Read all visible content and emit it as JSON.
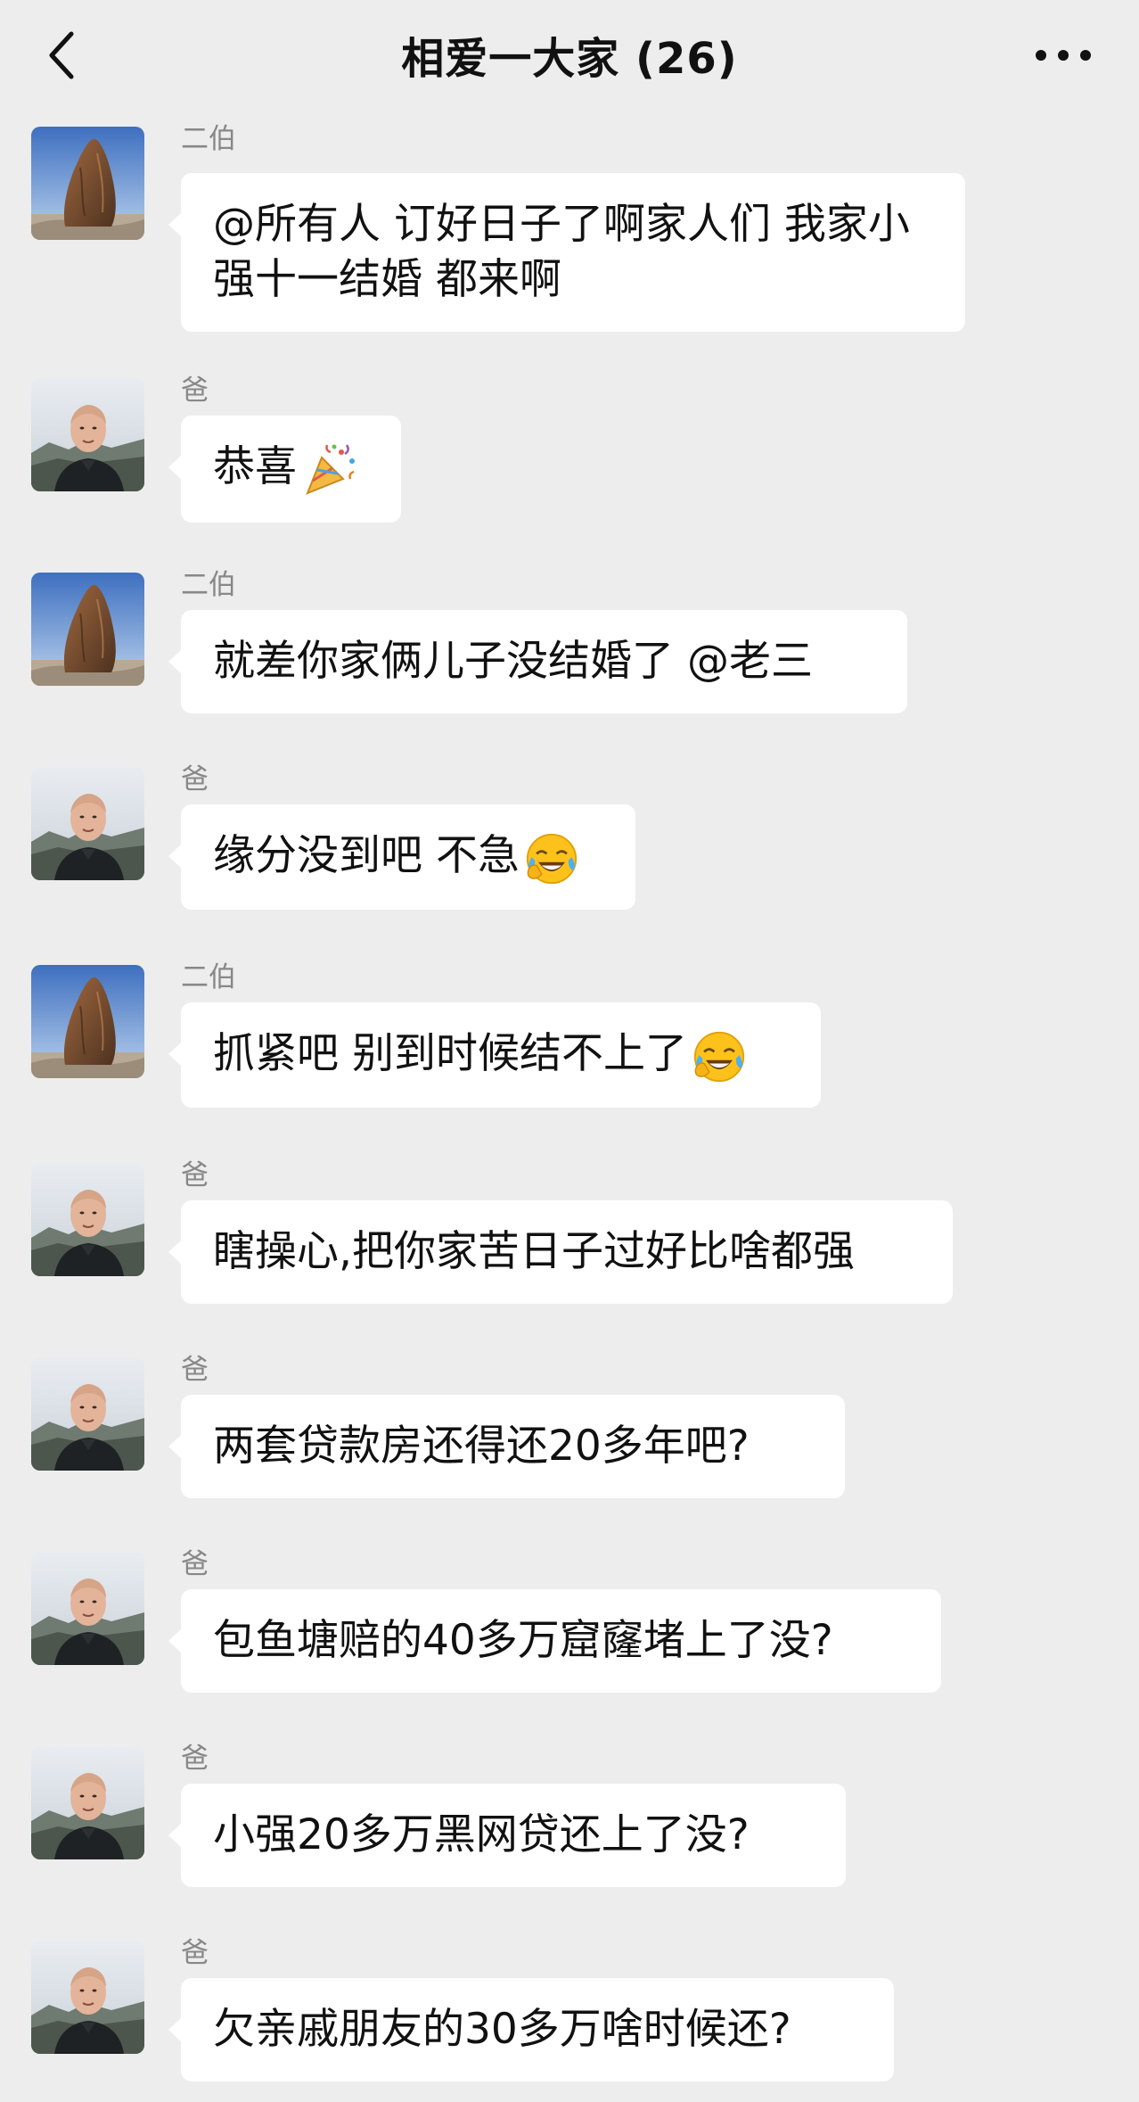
{
  "header": {
    "title": "相爱一大家 (26)",
    "back_icon": "chevron-left-icon",
    "more_icon": "more-dots-icon"
  },
  "messages": [
    {
      "sender": "二伯",
      "text": "@所有人 订好日子了啊家人们 我家小强十一结婚  都来啊"
    },
    {
      "sender": "爸",
      "text": "恭喜",
      "emoji": "party-popper-icon"
    },
    {
      "sender": "二伯",
      "text": "就差你家俩儿子没结婚了 @老三"
    },
    {
      "sender": "爸",
      "text": "缘分没到吧 不急",
      "emoji": "laugh-cry-emoji"
    },
    {
      "sender": "二伯",
      "text": "抓紧吧 别到时候结不上了",
      "emoji": "laugh-cry-emoji"
    },
    {
      "sender": "爸",
      "text": "瞎操心,把你家苦日子过好比啥都强"
    },
    {
      "sender": "爸",
      "text": "两套贷款房还得还20多年吧?"
    },
    {
      "sender": "爸",
      "text": "包鱼塘赔的40多万窟窿堵上了没?"
    },
    {
      "sender": "爸",
      "text": "小强20多万黑网贷还上了没?"
    },
    {
      "sender": "爸",
      "text": "欠亲戚朋友的30多万啥时候还?"
    }
  ],
  "colors": {
    "background": "#ededed",
    "bubble": "#ffffff",
    "sender_name": "#888888"
  }
}
